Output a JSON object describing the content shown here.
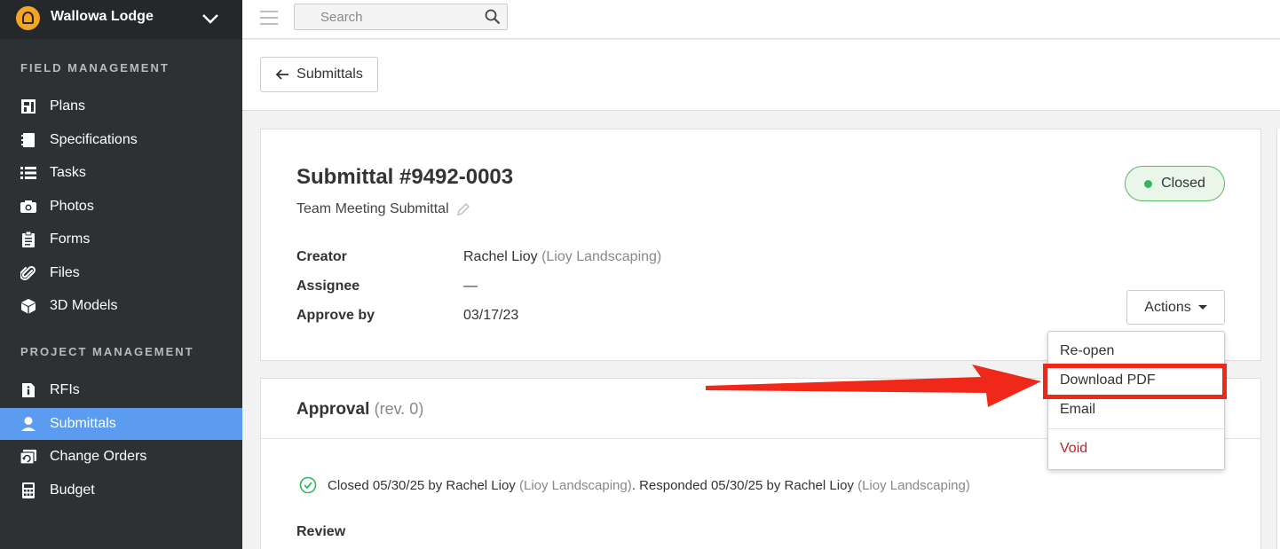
{
  "sidebar": {
    "project": "Wallowa Lodge",
    "sections": [
      {
        "title": "FIELD MANAGEMENT"
      },
      {
        "title": "PROJECT MANAGEMENT"
      }
    ],
    "items": [
      {
        "label": "Plans",
        "icon": "plans-icon"
      },
      {
        "label": "Specifications",
        "icon": "specifications-icon"
      },
      {
        "label": "Tasks",
        "icon": "tasks-icon"
      },
      {
        "label": "Photos",
        "icon": "camera-icon"
      },
      {
        "label": "Forms",
        "icon": "clipboard-icon"
      },
      {
        "label": "Files",
        "icon": "paperclip-icon"
      },
      {
        "label": "3D Models",
        "icon": "cube-icon"
      },
      {
        "label": "RFIs",
        "icon": "rfi-icon"
      },
      {
        "label": "Submittals",
        "icon": "person-icon",
        "active": true
      },
      {
        "label": "Change Orders",
        "icon": "change-orders-icon"
      },
      {
        "label": "Budget",
        "icon": "calculator-icon"
      }
    ],
    "accent_color": "#5b9cf0"
  },
  "topbar": {
    "search_placeholder": "Search"
  },
  "subheader": {
    "back_label": "Submittals"
  },
  "submittal": {
    "title": "Submittal #9492-0003",
    "subtitle": "Team Meeting Submittal",
    "status": "Closed",
    "fields": {
      "creator_label": "Creator",
      "creator_name": "Rachel Lioy",
      "creator_company": "(Lioy Landscaping)",
      "assignee_label": "Assignee",
      "assignee_value": "—",
      "approve_label": "Approve by",
      "approve_value": "03/17/23"
    },
    "actions_label": "Actions"
  },
  "dropdown": {
    "items": [
      "Re-open",
      "Download PDF",
      "Email",
      "Void"
    ]
  },
  "approval": {
    "title": "Approval",
    "rev": "(rev. 0)",
    "closed_text_1": "Closed 05/30/25 by Rachel Lioy",
    "company_1": "(Lioy Landscaping)",
    "closed_text_2": ". Responded 05/30/25 by Rachel Lioy",
    "company_2": "(Lioy Landscaping)",
    "review_label": "Review"
  },
  "colors": {
    "status_green": "#2fb95a",
    "highlight_red": "#f0281a",
    "void_red": "#b5262c"
  }
}
